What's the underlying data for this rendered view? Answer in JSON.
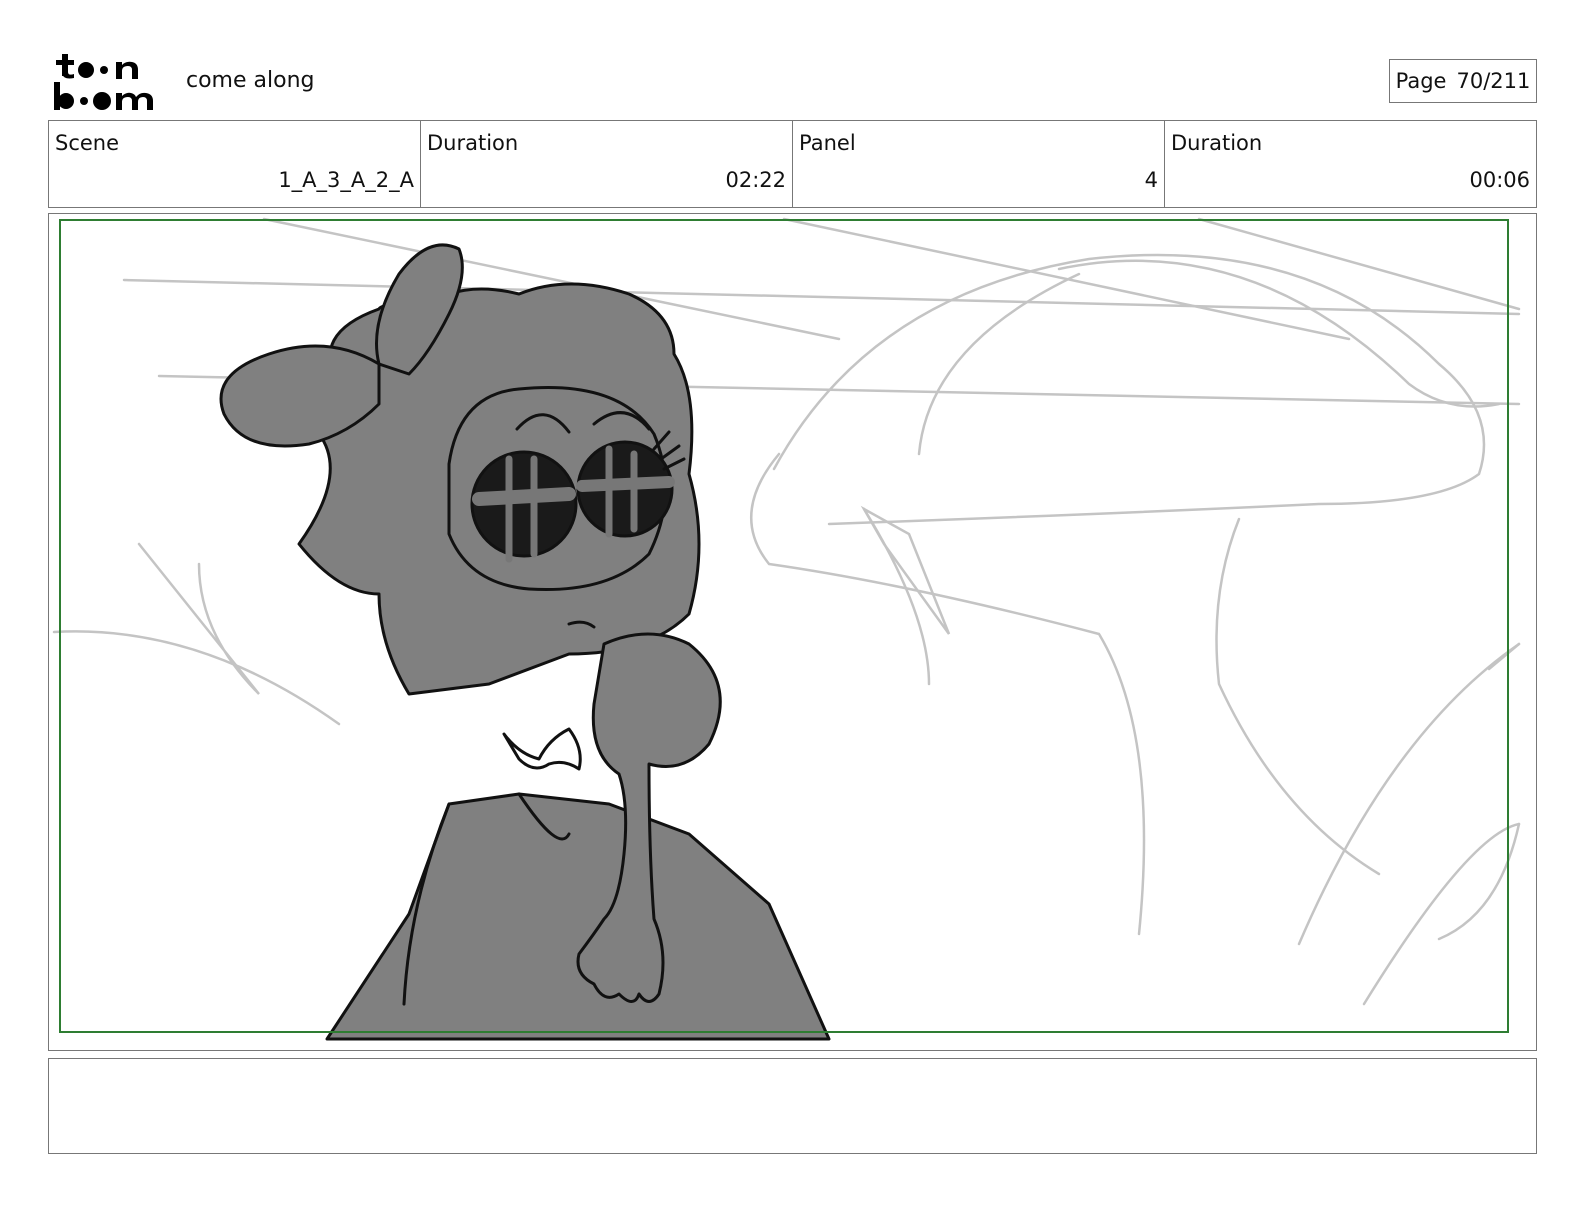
{
  "header": {
    "logo_text": "toon boom",
    "title": "come along",
    "page_label": "Page",
    "page_value": "70/211"
  },
  "info": {
    "scene_label": "Scene",
    "scene_value": "1_A_3_A_2_A",
    "scene_duration_label": "Duration",
    "scene_duration_value": "02:22",
    "panel_label": "Panel",
    "panel_value": "4",
    "panel_duration_label": "Duration",
    "panel_duration_value": "00:06"
  },
  "frame": {
    "safe_area_color": "#2e7d32",
    "character_fill": "#808080",
    "background_sketch_color": "#c4c4c4"
  },
  "notes": {
    "text": ""
  }
}
